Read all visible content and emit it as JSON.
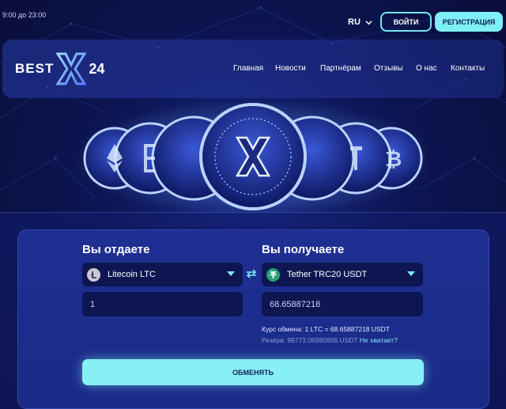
{
  "topbar": {
    "hours": "9:00 до 23:00",
    "language": "RU",
    "login_label": "ВОЙТИ",
    "register_label": "РЕГИСТРАЦИЯ"
  },
  "logo": {
    "best": "BEST",
    "x": "X",
    "num": "24"
  },
  "nav": {
    "items": [
      "Главная",
      "Новости",
      "Партнёрам",
      "Отзывы",
      "О нас",
      "Контакты"
    ]
  },
  "exchange": {
    "give_title": "Вы отдаете",
    "get_title": "Вы получаете",
    "give_currency": "Litecoin LTC",
    "get_currency": "Tether TRC20 USDT",
    "give_amount": "1",
    "get_amount": "68.65887218",
    "rate": "Курс обмена: 1 LTC = 68.65887218 USDT",
    "reserve": "Резерв: 99773.06980656 USDT",
    "not_enough": "Не хватает?",
    "submit_label": "ОБМЕНЯТЬ"
  },
  "colors": {
    "accent": "#7ef0f5",
    "background": "#0a0f3a",
    "panel": "#1e2f93",
    "field": "#0d1650"
  },
  "icons": {
    "language_caret": "chevron-down-icon",
    "give_coin": "litecoin-icon",
    "get_coin": "tether-icon",
    "swap": "swap-arrows-icon"
  }
}
